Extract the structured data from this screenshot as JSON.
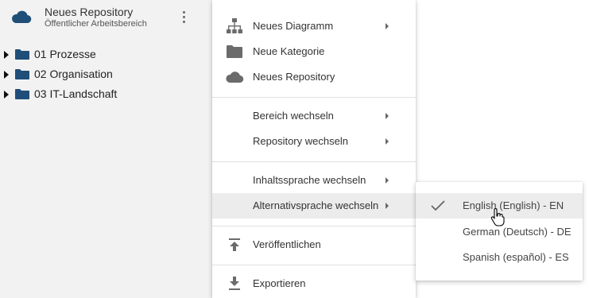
{
  "repository": {
    "title": "Neues Repository",
    "subtitle": "Öffentlicher Arbeitsbereich",
    "icon": "cloud-icon",
    "accent_color": "#1f4e79"
  },
  "tree": {
    "items": [
      {
        "label": "01 Prozesse",
        "icon": "folder-icon"
      },
      {
        "label": "02 Organisation",
        "icon": "folder-icon"
      },
      {
        "label": "03 IT-Landschaft",
        "icon": "folder-icon"
      }
    ]
  },
  "menu": {
    "items": [
      {
        "label": "Neues Diagramm",
        "icon": "hierarchy-icon",
        "has_submenu": true
      },
      {
        "label": "Neue Kategorie",
        "icon": "folder-icon",
        "has_submenu": false
      },
      {
        "label": "Neues Repository",
        "icon": "cloud-icon",
        "has_submenu": false
      },
      {
        "label": "Bereich wechseln",
        "icon": "",
        "has_submenu": true
      },
      {
        "label": "Repository wechseln",
        "icon": "",
        "has_submenu": true
      },
      {
        "label": "Inhaltssprache wechseln",
        "icon": "",
        "has_submenu": true
      },
      {
        "label": "Alternativsprache wechseln",
        "icon": "",
        "has_submenu": true,
        "active": true
      },
      {
        "label": "Veröffentlichen",
        "icon": "publish-icon",
        "has_submenu": false
      },
      {
        "label": "Exportieren",
        "icon": "download-icon",
        "has_submenu": false
      }
    ]
  },
  "submenu": {
    "items": [
      {
        "label": "English (English) - EN",
        "selected": true
      },
      {
        "label": "German (Deutsch) - DE",
        "selected": false
      },
      {
        "label": "Spanish (español) - ES",
        "selected": false
      }
    ]
  },
  "colors": {
    "icon_gray": "#6b6b6b",
    "folder_blue": "#1f4e79",
    "menu_active_bg": "#ececec"
  }
}
